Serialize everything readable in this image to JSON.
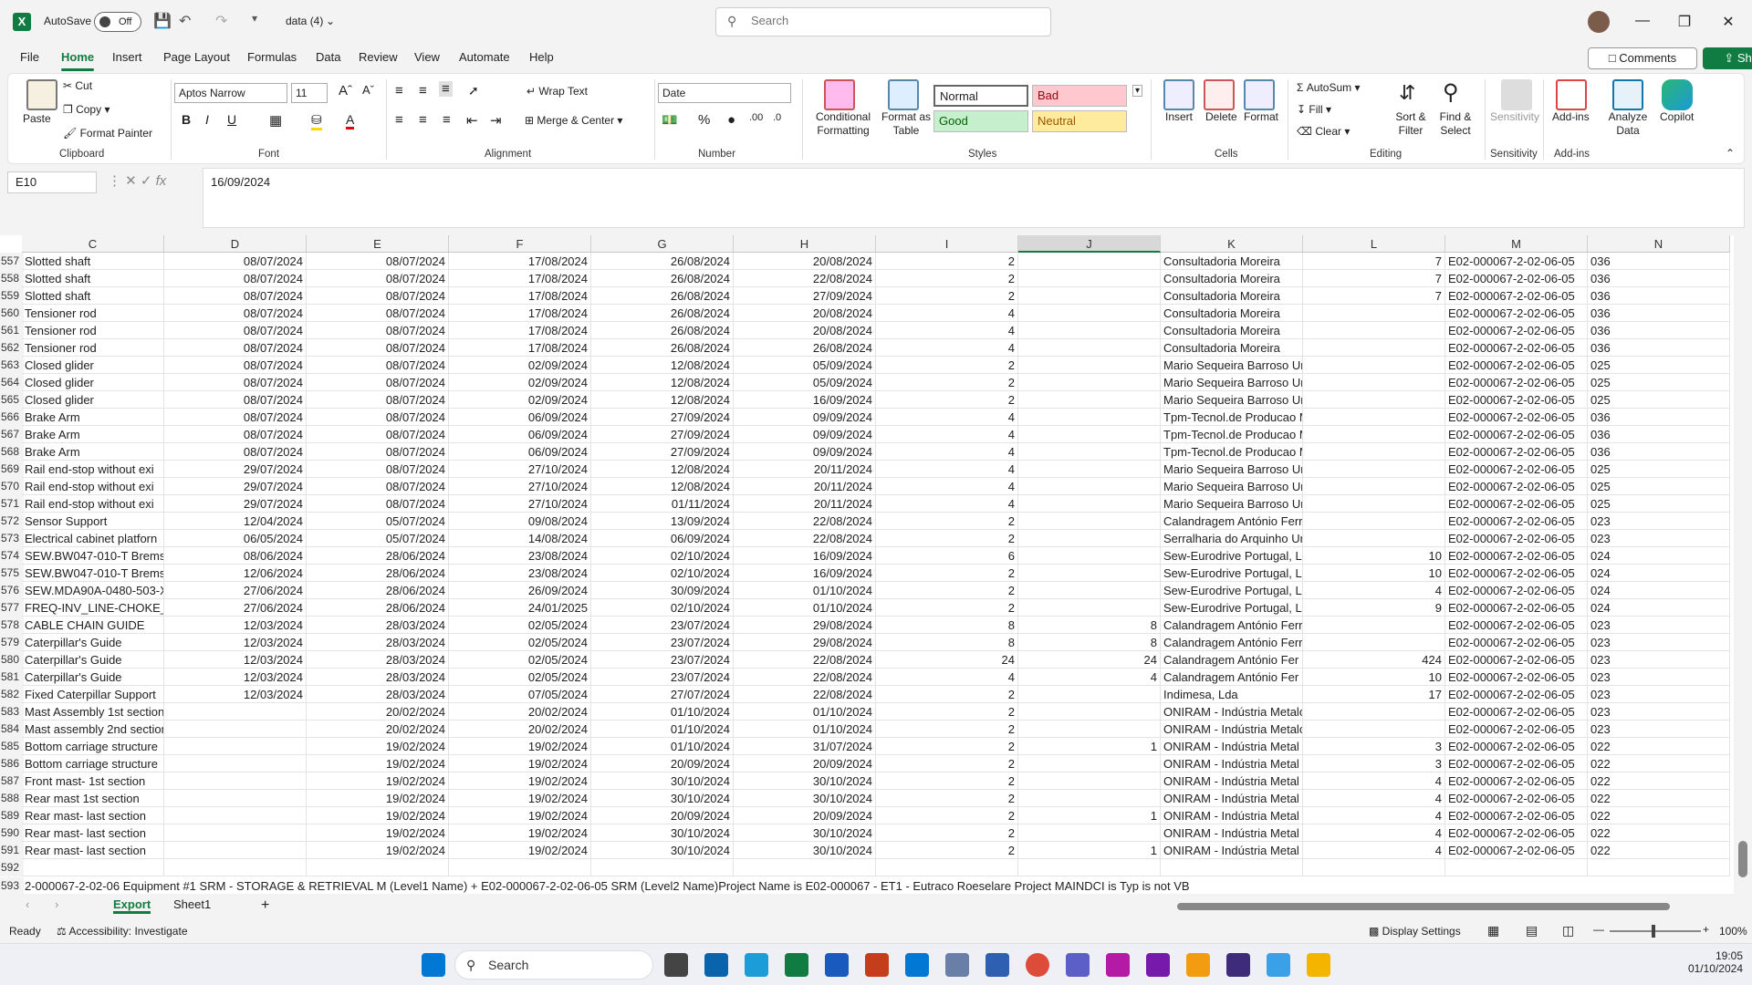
{
  "titlebar": {
    "autosave_label": "AutoSave",
    "autosave_state": "Off",
    "filename": "data (4)",
    "search_placeholder": "Search"
  },
  "menu": {
    "tabs": [
      "File",
      "Home",
      "Insert",
      "Page Layout",
      "Formulas",
      "Data",
      "Review",
      "View",
      "Automate",
      "Help"
    ],
    "active": "Home",
    "comments": "Comments",
    "share": "Share"
  },
  "ribbon": {
    "clipboard": {
      "label": "Clipboard",
      "paste": "Paste",
      "cut": "Cut",
      "copy": "Copy",
      "format_painter": "Format Painter"
    },
    "font": {
      "label": "Font",
      "font_name": "Aptos Narrow",
      "font_size": "11"
    },
    "alignment": {
      "label": "Alignment",
      "wrap_text": "Wrap Text",
      "merge_center": "Merge & Center"
    },
    "number": {
      "label": "Number",
      "format": "Date"
    },
    "styles": {
      "label": "Styles",
      "conditional": "Conditional Formatting",
      "format_table": "Format as Table",
      "normal": "Normal",
      "bad": "Bad",
      "good": "Good",
      "neutral": "Neutral"
    },
    "cells": {
      "label": "Cells",
      "insert": "Insert",
      "delete": "Delete",
      "format": "Format"
    },
    "editing": {
      "label": "Editing",
      "autosum": "AutoSum",
      "fill": "Fill",
      "clear": "Clear",
      "sort_filter": "Sort & Filter",
      "find_select": "Find & Select"
    },
    "sensitivity": {
      "label": "Sensitivity",
      "btn": "Sensitivity"
    },
    "addins": {
      "label": "Add-ins",
      "btn": "Add-ins",
      "analyze": "Analyze Data",
      "copilot": "Copilot"
    }
  },
  "formula": {
    "namebox": "E10",
    "value": "16/09/2024"
  },
  "grid": {
    "columns": [
      "C",
      "D",
      "E",
      "F",
      "G",
      "H",
      "I",
      "J",
      "K",
      "L",
      "M",
      "N"
    ],
    "selected_column": "J",
    "rows": [
      {
        "n": "557",
        "c": "Slotted shaft",
        "d": "08/07/2024",
        "e": "08/07/2024",
        "f": "17/08/2024",
        "g": "26/08/2024",
        "h": "20/08/2024",
        "i": "2",
        "j": "",
        "k": "Consultadoria Moreira",
        "l": "7",
        "m": "E02-000067-2-02-06-05",
        "o": "036"
      },
      {
        "n": "558",
        "c": "Slotted shaft",
        "d": "08/07/2024",
        "e": "08/07/2024",
        "f": "17/08/2024",
        "g": "26/08/2024",
        "h": "22/08/2024",
        "i": "2",
        "j": "",
        "k": "Consultadoria Moreira",
        "l": "7",
        "m": "E02-000067-2-02-06-05",
        "o": "036"
      },
      {
        "n": "559",
        "c": "Slotted shaft",
        "d": "08/07/2024",
        "e": "08/07/2024",
        "f": "17/08/2024",
        "g": "26/08/2024",
        "h": "27/09/2024",
        "i": "2",
        "j": "",
        "k": "Consultadoria Moreira",
        "l": "7",
        "m": "E02-000067-2-02-06-05",
        "o": "036"
      },
      {
        "n": "560",
        "c": "Tensioner rod",
        "d": "08/07/2024",
        "e": "08/07/2024",
        "f": "17/08/2024",
        "g": "26/08/2024",
        "h": "20/08/2024",
        "i": "4",
        "j": "",
        "k": "Consultadoria Moreira",
        "l": "",
        "m": "E02-000067-2-02-06-05",
        "o": "036"
      },
      {
        "n": "561",
        "c": "Tensioner rod",
        "d": "08/07/2024",
        "e": "08/07/2024",
        "f": "17/08/2024",
        "g": "26/08/2024",
        "h": "20/08/2024",
        "i": "4",
        "j": "",
        "k": "Consultadoria Moreira",
        "l": "",
        "m": "E02-000067-2-02-06-05",
        "o": "036"
      },
      {
        "n": "562",
        "c": "Tensioner rod",
        "d": "08/07/2024",
        "e": "08/07/2024",
        "f": "17/08/2024",
        "g": "26/08/2024",
        "h": "26/08/2024",
        "i": "4",
        "j": "",
        "k": "Consultadoria Moreira",
        "l": "",
        "m": "E02-000067-2-02-06-05",
        "o": "036"
      },
      {
        "n": "563",
        "c": "Closed glider",
        "d": "08/07/2024",
        "e": "08/07/2024",
        "f": "02/09/2024",
        "g": "12/08/2024",
        "h": "05/09/2024",
        "i": "2",
        "j": "",
        "k": "Mario Sequeira Barroso Unip., Lda",
        "l": "",
        "m": "E02-000067-2-02-06-05",
        "o": "025"
      },
      {
        "n": "564",
        "c": "Closed glider",
        "d": "08/07/2024",
        "e": "08/07/2024",
        "f": "02/09/2024",
        "g": "12/08/2024",
        "h": "05/09/2024",
        "i": "2",
        "j": "",
        "k": "Mario Sequeira Barroso Unip., Lda",
        "l": "",
        "m": "E02-000067-2-02-06-05",
        "o": "025"
      },
      {
        "n": "565",
        "c": "Closed glider",
        "d": "08/07/2024",
        "e": "08/07/2024",
        "f": "02/09/2024",
        "g": "12/08/2024",
        "h": "16/09/2024",
        "i": "2",
        "j": "",
        "k": "Mario Sequeira Barroso Unip., Lda",
        "l": "",
        "m": "E02-000067-2-02-06-05",
        "o": "025"
      },
      {
        "n": "566",
        "c": "Brake Arm",
        "d": "08/07/2024",
        "e": "08/07/2024",
        "f": "06/09/2024",
        "g": "27/09/2024",
        "h": "09/09/2024",
        "i": "4",
        "j": "",
        "k": "Tpm-Tecnol.de Producao Mec.Lda",
        "l": "",
        "m": "E02-000067-2-02-06-05",
        "o": "036"
      },
      {
        "n": "567",
        "c": "Brake Arm",
        "d": "08/07/2024",
        "e": "08/07/2024",
        "f": "06/09/2024",
        "g": "27/09/2024",
        "h": "09/09/2024",
        "i": "4",
        "j": "",
        "k": "Tpm-Tecnol.de Producao Mec.Lda",
        "l": "",
        "m": "E02-000067-2-02-06-05",
        "o": "036"
      },
      {
        "n": "568",
        "c": "Brake Arm",
        "d": "08/07/2024",
        "e": "08/07/2024",
        "f": "06/09/2024",
        "g": "27/09/2024",
        "h": "09/09/2024",
        "i": "4",
        "j": "",
        "k": "Tpm-Tecnol.de Producao Mec.Lda",
        "l": "",
        "m": "E02-000067-2-02-06-05",
        "o": "036"
      },
      {
        "n": "569",
        "c": "Rail end-stop without exi",
        "d": "29/07/2024",
        "e": "08/07/2024",
        "f": "27/10/2024",
        "g": "12/08/2024",
        "h": "20/11/2024",
        "i": "4",
        "j": "",
        "k": "Mario Sequeira Barroso Unip., Lda",
        "l": "",
        "m": "E02-000067-2-02-06-05",
        "o": "025"
      },
      {
        "n": "570",
        "c": "Rail end-stop without exi",
        "d": "29/07/2024",
        "e": "08/07/2024",
        "f": "27/10/2024",
        "g": "12/08/2024",
        "h": "20/11/2024",
        "i": "4",
        "j": "",
        "k": "Mario Sequeira Barroso Unip., Lda",
        "l": "",
        "m": "E02-000067-2-02-06-05",
        "o": "025"
      },
      {
        "n": "571",
        "c": "Rail end-stop without exi",
        "d": "29/07/2024",
        "e": "08/07/2024",
        "f": "27/10/2024",
        "g": "01/11/2024",
        "h": "20/11/2024",
        "i": "4",
        "j": "",
        "k": "Mario Sequeira Barroso Unip., Lda",
        "l": "",
        "m": "E02-000067-2-02-06-05",
        "o": "025"
      },
      {
        "n": "572",
        "c": "Sensor Support",
        "d": "12/04/2024",
        "e": "05/07/2024",
        "f": "09/08/2024",
        "g": "13/09/2024",
        "h": "22/08/2024",
        "i": "2",
        "j": "",
        "k": "Calandragem António Ferreira Rib.,",
        "l": "",
        "m": "E02-000067-2-02-06-05",
        "o": "023"
      },
      {
        "n": "573",
        "c": "Electrical cabinet platforn",
        "d": "06/05/2024",
        "e": "05/07/2024",
        "f": "14/08/2024",
        "g": "06/09/2024",
        "h": "22/08/2024",
        "i": "2",
        "j": "",
        "k": "Serralharia do Arquinho Unipessoal",
        "l": "",
        "m": "E02-000067-2-02-06-05",
        "o": "023"
      },
      {
        "n": "574",
        "c": "SEW.BW047-010-T Bremsv",
        "d": "08/06/2024",
        "e": "28/06/2024",
        "f": "23/08/2024",
        "g": "02/10/2024",
        "h": "16/09/2024",
        "i": "6",
        "j": "",
        "k": "Sew-Eurodrive Portugal, L",
        "l": "10",
        "m": "E02-000067-2-02-06-05",
        "o": "024"
      },
      {
        "n": "575",
        "c": "SEW.BW047-010-T Bremsv",
        "d": "12/06/2024",
        "e": "28/06/2024",
        "f": "23/08/2024",
        "g": "02/10/2024",
        "h": "16/09/2024",
        "i": "2",
        "j": "",
        "k": "Sew-Eurodrive Portugal, L",
        "l": "10",
        "m": "E02-000067-2-02-06-05",
        "o": "024"
      },
      {
        "n": "576",
        "c": "SEW.MDA90A-0480-503-X",
        "d": "27/06/2024",
        "e": "28/06/2024",
        "f": "26/09/2024",
        "g": "30/09/2024",
        "h": "01/10/2024",
        "i": "2",
        "j": "",
        "k": "Sew-Eurodrive Portugal, L",
        "l": "4",
        "m": "E02-000067-2-02-06-05",
        "o": "024"
      },
      {
        "n": "577",
        "c": "FREQ-INV_LINE-CHOKE_9",
        "d": "27/06/2024",
        "e": "28/06/2024",
        "f": "24/01/2025",
        "g": "02/10/2024",
        "h": "01/10/2024",
        "i": "2",
        "j": "",
        "k": "Sew-Eurodrive Portugal, L",
        "l": "9",
        "m": "E02-000067-2-02-06-05",
        "o": "024"
      },
      {
        "n": "578",
        "c": "CABLE CHAIN GUIDE",
        "d": "12/03/2024",
        "e": "28/03/2024",
        "f": "02/05/2024",
        "g": "23/07/2024",
        "h": "29/08/2024",
        "i": "8",
        "j": "8",
        "k": "Calandragem António Ferreira Rib.,",
        "l": "",
        "m": "E02-000067-2-02-06-05",
        "o": "023"
      },
      {
        "n": "579",
        "c": "Caterpillar's Guide",
        "d": "12/03/2024",
        "e": "28/03/2024",
        "f": "02/05/2024",
        "g": "23/07/2024",
        "h": "29/08/2024",
        "i": "8",
        "j": "8",
        "k": "Calandragem António Ferreira Rib.,",
        "l": "",
        "m": "E02-000067-2-02-06-05",
        "o": "023"
      },
      {
        "n": "580",
        "c": "Caterpillar's Guide",
        "d": "12/03/2024",
        "e": "28/03/2024",
        "f": "02/05/2024",
        "g": "23/07/2024",
        "h": "22/08/2024",
        "i": "24",
        "j": "24",
        "k": "Calandragem António Fer",
        "l": "424",
        "m": "E02-000067-2-02-06-05",
        "o": "023"
      },
      {
        "n": "581",
        "c": "Caterpillar's Guide",
        "d": "12/03/2024",
        "e": "28/03/2024",
        "f": "02/05/2024",
        "g": "23/07/2024",
        "h": "22/08/2024",
        "i": "4",
        "j": "4",
        "k": "Calandragem António Fer",
        "l": "10",
        "m": "E02-000067-2-02-06-05",
        "o": "023"
      },
      {
        "n": "582",
        "c": "Fixed Caterpillar Support",
        "d": "12/03/2024",
        "e": "28/03/2024",
        "f": "07/05/2024",
        "g": "27/07/2024",
        "h": "22/08/2024",
        "i": "2",
        "j": "",
        "k": "Indimesa, Lda",
        "l": "17",
        "m": "E02-000067-2-02-06-05",
        "o": "023"
      },
      {
        "n": "583",
        "c": "Mast Assembly 1st section",
        "d": "",
        "e": "20/02/2024",
        "f": "20/02/2024",
        "g": "01/10/2024",
        "h": "01/10/2024",
        "i": "2",
        "j": "",
        "k": "ONIRAM - Indústria Metalomecânica",
        "l": "",
        "m": "E02-000067-2-02-06-05",
        "o": "023"
      },
      {
        "n": "584",
        "c": "Mast assembly 2nd section",
        "d": "",
        "e": "20/02/2024",
        "f": "20/02/2024",
        "g": "01/10/2024",
        "h": "01/10/2024",
        "i": "2",
        "j": "",
        "k": "ONIRAM - Indústria Metalomecânica",
        "l": "",
        "m": "E02-000067-2-02-06-05",
        "o": "023"
      },
      {
        "n": "585",
        "c": "Bottom carriage structure",
        "d": "",
        "e": "19/02/2024",
        "f": "19/02/2024",
        "g": "01/10/2024",
        "h": "31/07/2024",
        "i": "2",
        "j": "1",
        "k": "ONIRAM - Indústria Metal",
        "l": "3",
        "m": "E02-000067-2-02-06-05",
        "o": "022"
      },
      {
        "n": "586",
        "c": "Bottom carriage structure",
        "d": "",
        "e": "19/02/2024",
        "f": "19/02/2024",
        "g": "20/09/2024",
        "h": "20/09/2024",
        "i": "2",
        "j": "",
        "k": "ONIRAM - Indústria Metal",
        "l": "3",
        "m": "E02-000067-2-02-06-05",
        "o": "022"
      },
      {
        "n": "587",
        "c": "Front mast- 1st section",
        "d": "",
        "e": "19/02/2024",
        "f": "19/02/2024",
        "g": "30/10/2024",
        "h": "30/10/2024",
        "i": "2",
        "j": "",
        "k": "ONIRAM - Indústria Metal",
        "l": "4",
        "m": "E02-000067-2-02-06-05",
        "o": "022"
      },
      {
        "n": "588",
        "c": "Rear mast 1st section",
        "d": "",
        "e": "19/02/2024",
        "f": "19/02/2024",
        "g": "30/10/2024",
        "h": "30/10/2024",
        "i": "2",
        "j": "",
        "k": "ONIRAM - Indústria Metal",
        "l": "4",
        "m": "E02-000067-2-02-06-05",
        "o": "022"
      },
      {
        "n": "589",
        "c": "Rear mast- last section",
        "d": "",
        "e": "19/02/2024",
        "f": "19/02/2024",
        "g": "20/09/2024",
        "h": "20/09/2024",
        "i": "2",
        "j": "1",
        "k": "ONIRAM - Indústria Metal",
        "l": "4",
        "m": "E02-000067-2-02-06-05",
        "o": "022"
      },
      {
        "n": "590",
        "c": "Rear mast- last section",
        "d": "",
        "e": "19/02/2024",
        "f": "19/02/2024",
        "g": "30/10/2024",
        "h": "30/10/2024",
        "i": "2",
        "j": "",
        "k": "ONIRAM - Indústria Metal",
        "l": "4",
        "m": "E02-000067-2-02-06-05",
        "o": "022"
      },
      {
        "n": "591",
        "c": "Rear mast- last section",
        "d": "",
        "e": "19/02/2024",
        "f": "19/02/2024",
        "g": "30/10/2024",
        "h": "30/10/2024",
        "i": "2",
        "j": "1",
        "k": "ONIRAM - Indústria Metal",
        "l": "4",
        "m": "E02-000067-2-02-06-05",
        "o": "022"
      },
      {
        "n": "592",
        "c": "",
        "d": "",
        "e": "",
        "f": "",
        "g": "",
        "h": "",
        "i": "",
        "j": "",
        "k": "",
        "l": "",
        "m": "",
        "o": ""
      }
    ],
    "footer_row": {
      "n": "593",
      "text": "2-000067-2-02-06       Equipment #1 SRM - STORAGE & RETRIEVAL M (Level1  Name) + E02-000067-2-02-06-05       SRM (Level2  Name)Project Name is E02-000067 - ET1 - Eutraco Roeselare Project MAINDCI is Typ is not VB"
    }
  },
  "sheets": {
    "tabs": [
      "Export",
      "Sheet1"
    ],
    "active": "Export"
  },
  "status": {
    "ready": "Ready",
    "accessibility": "Accessibility: Investigate",
    "display_settings": "Display Settings",
    "zoom": "100%"
  },
  "taskbar": {
    "search": "Search",
    "time": "19:05",
    "date": "01/10/2024"
  }
}
